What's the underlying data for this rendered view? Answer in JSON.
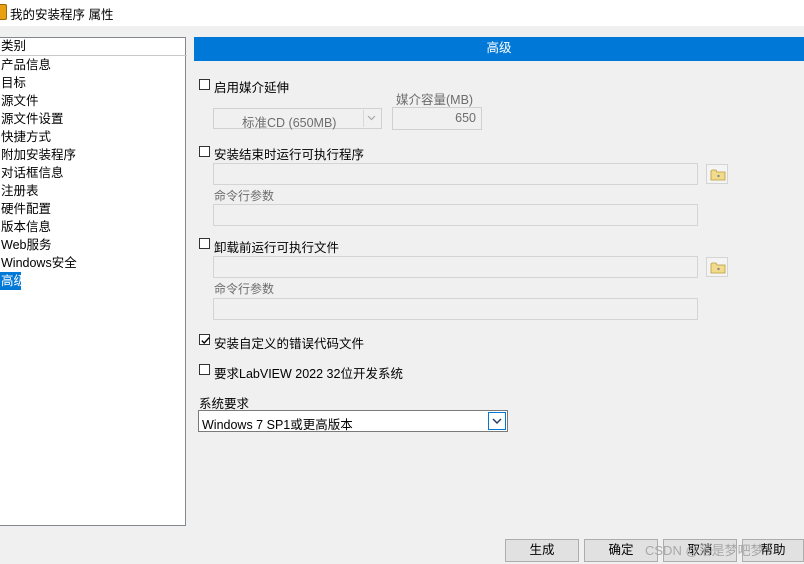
{
  "window": {
    "title": "我的安装程序 属性"
  },
  "sidebar": {
    "header": "类别",
    "items": [
      {
        "label": "产品信息"
      },
      {
        "label": "目标"
      },
      {
        "label": "源文件"
      },
      {
        "label": "源文件设置"
      },
      {
        "label": "快捷方式"
      },
      {
        "label": "附加安装程序"
      },
      {
        "label": "对话框信息"
      },
      {
        "label": "注册表"
      },
      {
        "label": "硬件配置"
      },
      {
        "label": "版本信息"
      },
      {
        "label": "Web服务"
      },
      {
        "label": "Windows安全"
      },
      {
        "label": "高级",
        "selected": true
      }
    ]
  },
  "main": {
    "title": "高级",
    "media_span": {
      "label": "启用媒介延伸",
      "checked": false,
      "media_type_value": "标准CD (650MB)",
      "capacity_label": "媒介容量(MB)",
      "capacity_value": "650"
    },
    "post_install": {
      "label": "安装结束时运行可执行程序",
      "checked": false,
      "path_value": "",
      "args_label": "命令行参数",
      "args_value": ""
    },
    "pre_uninstall": {
      "label": "卸载前运行可执行文件",
      "checked": false,
      "path_value": "",
      "args_label": "命令行参数",
      "args_value": ""
    },
    "custom_error_codes": {
      "label": "安装自定义的错误代码文件",
      "checked": true
    },
    "require_labview": {
      "label": "要求LabVIEW 2022 32位开发系统",
      "checked": false
    },
    "system_requirements": {
      "label": "系统要求",
      "selected": "Windows 7 SP1或更高版本"
    }
  },
  "footer": {
    "build": "生成",
    "ok": "确定",
    "cancel": "取消",
    "help": "帮助",
    "watermark": "CSDN @落是梦吧梦"
  },
  "colors": {
    "accent": "#0078d7",
    "window_bg": "#f0f0f0"
  }
}
